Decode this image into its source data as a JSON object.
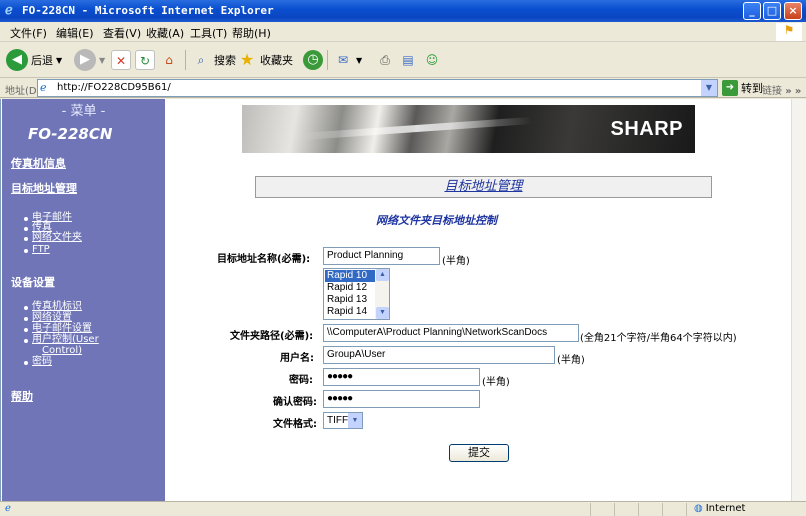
{
  "window": {
    "title": "FO-228CN - Microsoft Internet Explorer",
    "controls": [
      "_",
      "□",
      "×"
    ]
  },
  "menubar": [
    "文件(F)",
    "编辑(E)",
    "查看(V)",
    "收藏(A)",
    "工具(T)",
    "帮助(H)"
  ],
  "toolbar": {
    "back": "后退",
    "search": "搜索",
    "favorites": "收藏夹"
  },
  "address": {
    "label": "地址(D)",
    "url": "http://FO228CD95B61/",
    "go": "转到",
    "links": "链接"
  },
  "sidebar": {
    "heading": "- 菜单 -",
    "model": "FO-228CN",
    "fax_info": "传真机信息",
    "dest_mgmt": "目标地址管理",
    "dest_items": [
      "电子邮件",
      "传真",
      "网络文件夹",
      "FTP"
    ],
    "device_settings": "设备设置",
    "device_items": [
      "传真机标识",
      "网络设置",
      "电子邮件设置",
      "用户控制(User",
      "Control)",
      "密码"
    ],
    "help": "帮助"
  },
  "banner": {
    "logo": "SHARP"
  },
  "main": {
    "page_title": "目标地址管理",
    "section_title": "网络文件夹目标地址控制",
    "fields": {
      "dest_name": {
        "label": "目标地址名称(必需):",
        "value": "Product Planning",
        "hint": "(半角)"
      },
      "rapid_list": {
        "items": [
          "Rapid 10",
          "Rapid 12",
          "Rapid 13",
          "Rapid 14"
        ],
        "selected": "Rapid 10"
      },
      "folder_path": {
        "label": "文件夹路径(必需):",
        "value": "\\\\ComputerA\\Product Planning\\NetworkScanDocs",
        "hint": "(全角21个字符/半角64个字符以内)"
      },
      "username": {
        "label": "用户名:",
        "value": "GroupA\\User",
        "hint": "(半角)"
      },
      "password": {
        "label": "密码:",
        "value": "●●●●●",
        "hint": "(半角)"
      },
      "confirm_password": {
        "label": "确认密码:",
        "value": "●●●●●"
      },
      "file_format": {
        "label": "文件格式:",
        "value": "TIFF"
      }
    },
    "submit": "提交"
  },
  "statusbar": {
    "zone": "Internet"
  }
}
